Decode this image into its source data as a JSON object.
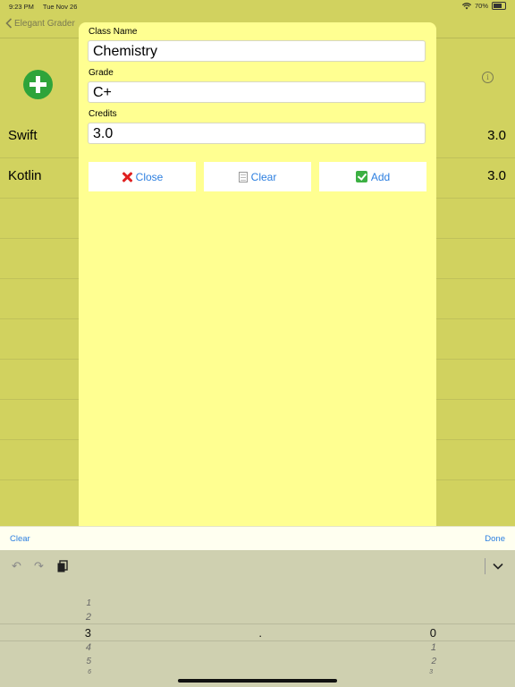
{
  "status": {
    "time": "9:23 PM",
    "date": "Tue Nov 26",
    "battery": "70%",
    "battery_level": 0.7
  },
  "nav": {
    "back_label": "Elegant Grader"
  },
  "list": {
    "rows": [
      {
        "name": "Swift",
        "credits": "3.0"
      },
      {
        "name": "Kotlin",
        "credits": "3.0"
      }
    ]
  },
  "modal": {
    "class_name_label": "Class Name",
    "class_name_value": "Chemistry",
    "grade_label": "Grade",
    "grade_value": "C+",
    "credits_label": "Credits",
    "credits_value": "3.0",
    "close_label": "Close",
    "clear_label": "Clear",
    "add_label": "Add"
  },
  "accessory": {
    "clear_label": "Clear",
    "done_label": "Done"
  },
  "picker": {
    "col1": {
      "above": [
        "1",
        "2"
      ],
      "selected": "3",
      "below": [
        "4",
        "5",
        "6"
      ]
    },
    "col2": {
      "selected": "."
    },
    "col3": {
      "selected": "0",
      "below": [
        "1",
        "2",
        "3"
      ]
    }
  },
  "colors": {
    "background": "#d1d25f",
    "modal": "#ffff91",
    "accent": "#2d7fe0",
    "add_icon": "#2ea43a"
  }
}
